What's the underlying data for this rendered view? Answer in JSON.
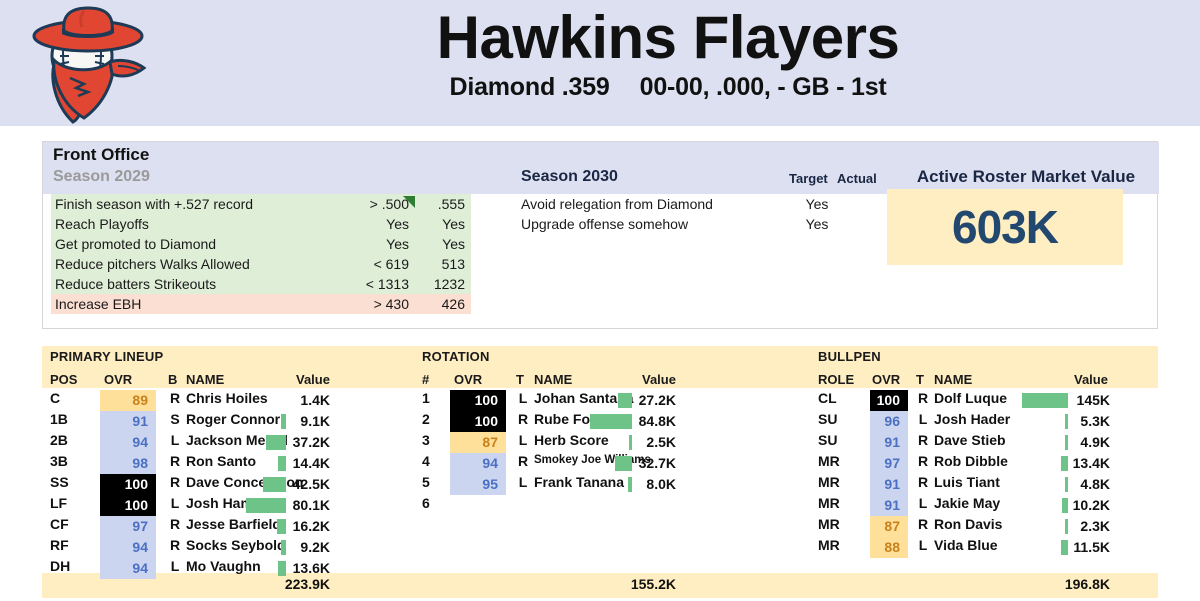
{
  "header": {
    "team_name": "Hawkins Flayers",
    "league": "Diamond .359",
    "record": "00-00, .000, - GB - 1st",
    "logo_name": "baseball-cowboy-logo",
    "bg_color": "#dde0f0"
  },
  "front_office": {
    "title": "Front Office",
    "season_2029_label": "Season 2029",
    "season_2030_label": "Season 2030",
    "target_header": "Target",
    "actual_header": "Actual",
    "goals_2029": [
      {
        "label": "Finish season with +.527 record",
        "target": "> .500",
        "actual": ".555",
        "status": "ok",
        "marker": true
      },
      {
        "label": "Reach Playoffs",
        "target": "Yes",
        "actual": "Yes",
        "status": "ok",
        "marker": false
      },
      {
        "label": "Get promoted to Diamond",
        "target": "Yes",
        "actual": "Yes",
        "status": "ok",
        "marker": false
      },
      {
        "label": "Reduce pitchers Walks Allowed",
        "target": "< 619",
        "actual": "513",
        "status": "ok",
        "marker": false
      },
      {
        "label": "Reduce batters Strikeouts",
        "target": "< 1313",
        "actual": "1232",
        "status": "ok",
        "marker": false
      },
      {
        "label": "Increase EBH",
        "target": "> 430",
        "actual": "426",
        "status": "bad",
        "marker": false
      }
    ],
    "goals_2030": [
      {
        "label": "Avoid relegation from Diamond",
        "target": "Yes",
        "actual": ""
      },
      {
        "label": "Upgrade offense somehow",
        "target": "Yes",
        "actual": ""
      }
    ],
    "market_value": {
      "title": "Active Roster Market Value",
      "value": "603K"
    },
    "colors": {
      "ok": "#dfeed7",
      "bad": "#fbdfd2",
      "band": "#dde0f0",
      "money": "#ffeec2"
    }
  },
  "roster": {
    "colors": {
      "band": "#ffeec2",
      "ovr_blue_bg": "#ccd5ef",
      "ovr_blue_text": "#4a6fc4",
      "ovr_yellow_bg": "#ffe09a",
      "ovr_yellow_text": "#c9811b",
      "ovr_max_bg": "#000000",
      "ovr_max_text": "#ffffff",
      "value_bar": "#6ec388"
    },
    "lineup": {
      "title": "PRIMARY LINEUP",
      "columns": [
        "POS",
        "OVR",
        "B",
        "NAME",
        "Value"
      ],
      "rows": [
        {
          "pos": "C",
          "ovr": "89",
          "ovr_style": "yellow",
          "hand": "R",
          "name": "Chris Hoiles",
          "value": "1.4K",
          "bar": 0
        },
        {
          "pos": "1B",
          "ovr": "91",
          "ovr_style": "blue",
          "hand": "S",
          "name": "Roger Connor",
          "value": "9.1K",
          "bar": 5
        },
        {
          "pos": "2B",
          "ovr": "94",
          "ovr_style": "blue",
          "hand": "L",
          "name": "Jackson Merrill",
          "value": "37.2K",
          "bar": 20
        },
        {
          "pos": "3B",
          "ovr": "98",
          "ovr_style": "blue",
          "hand": "R",
          "name": "Ron Santo",
          "value": "14.4K",
          "bar": 8
        },
        {
          "pos": "SS",
          "ovr": "100",
          "ovr_style": "black",
          "hand": "R",
          "name": "Dave Concepcion",
          "value": "42.5K",
          "bar": 23
        },
        {
          "pos": "LF",
          "ovr": "100",
          "ovr_style": "black",
          "hand": "L",
          "name": "Josh Hamilton",
          "value": "80.1K",
          "bar": 40
        },
        {
          "pos": "CF",
          "ovr": "97",
          "ovr_style": "blue",
          "hand": "R",
          "name": "Jesse Barfield",
          "value": "16.2K",
          "bar": 9
        },
        {
          "pos": "RF",
          "ovr": "94",
          "ovr_style": "blue",
          "hand": "R",
          "name": "Socks Seybold",
          "value": "9.2K",
          "bar": 5
        },
        {
          "pos": "DH",
          "ovr": "94",
          "ovr_style": "blue",
          "hand": "L",
          "name": "Mo Vaughn",
          "value": "13.6K",
          "bar": 8
        }
      ],
      "total": "223.9K"
    },
    "rotation": {
      "title": "ROTATION",
      "columns": [
        "#",
        "OVR",
        "T",
        "NAME",
        "Value"
      ],
      "rows": [
        {
          "pos": "1",
          "ovr": "100",
          "ovr_style": "black",
          "hand": "L",
          "name": "Johan Santana",
          "value": "27.2K",
          "bar": 14,
          "small": false
        },
        {
          "pos": "2",
          "ovr": "100",
          "ovr_style": "black",
          "hand": "R",
          "name": "Rube Foster",
          "value": "84.8K",
          "bar": 42,
          "small": false
        },
        {
          "pos": "3",
          "ovr": "87",
          "ovr_style": "yellow",
          "hand": "L",
          "name": "Herb Score",
          "value": "2.5K",
          "bar": 3,
          "small": false
        },
        {
          "pos": "4",
          "ovr": "94",
          "ovr_style": "blue",
          "hand": "R",
          "name": "Smokey Joe Williams",
          "value": "32.7K",
          "bar": 17,
          "small": true
        },
        {
          "pos": "5",
          "ovr": "95",
          "ovr_style": "blue",
          "hand": "L",
          "name": "Frank Tanana",
          "value": "8.0K",
          "bar": 4,
          "small": false
        },
        {
          "pos": "6",
          "ovr": "",
          "ovr_style": "none",
          "hand": "",
          "name": "",
          "value": "",
          "bar": 0,
          "small": false
        }
      ],
      "total": "155.2K"
    },
    "bullpen": {
      "title": "BULLPEN",
      "columns": [
        "ROLE",
        "OVR",
        "T",
        "NAME",
        "Value"
      ],
      "rows": [
        {
          "pos": "CL",
          "ovr": "100",
          "ovr_style": "black",
          "hand": "R",
          "name": "Dolf Luque",
          "value": "145K",
          "bar": 46
        },
        {
          "pos": "SU",
          "ovr": "96",
          "ovr_style": "blue",
          "hand": "L",
          "name": "Josh Hader",
          "value": "5.3K",
          "bar": 3
        },
        {
          "pos": "SU",
          "ovr": "91",
          "ovr_style": "blue",
          "hand": "R",
          "name": "Dave Stieb",
          "value": "4.9K",
          "bar": 3
        },
        {
          "pos": "MR",
          "ovr": "97",
          "ovr_style": "blue",
          "hand": "R",
          "name": "Rob Dibble",
          "value": "13.4K",
          "bar": 7
        },
        {
          "pos": "MR",
          "ovr": "91",
          "ovr_style": "blue",
          "hand": "R",
          "name": "Luis Tiant",
          "value": "4.8K",
          "bar": 3
        },
        {
          "pos": "MR",
          "ovr": "91",
          "ovr_style": "blue",
          "hand": "L",
          "name": "Jakie May",
          "value": "10.2K",
          "bar": 6
        },
        {
          "pos": "MR",
          "ovr": "87",
          "ovr_style": "yellow",
          "hand": "R",
          "name": "Ron Davis",
          "value": "2.3K",
          "bar": 3
        },
        {
          "pos": "MR",
          "ovr": "88",
          "ovr_style": "yellow",
          "hand": "L",
          "name": "Vida Blue",
          "value": "11.5K",
          "bar": 7
        }
      ],
      "total": "196.8K"
    }
  }
}
